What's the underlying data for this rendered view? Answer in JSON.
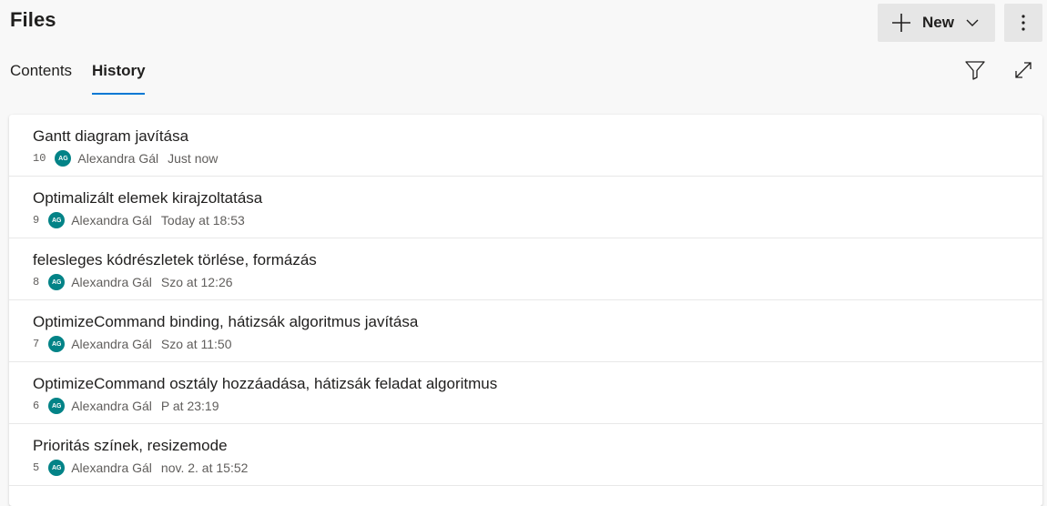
{
  "header": {
    "title": "Files",
    "new_label": "New"
  },
  "tabs": [
    {
      "label": "Contents",
      "active": false
    },
    {
      "label": "History",
      "active": true
    }
  ],
  "accent_color": "#0078d4",
  "avatar_color": "#038387",
  "commits": [
    {
      "id": "10",
      "message": "Gantt diagram javítása",
      "initials": "AG",
      "author": "Alexandra Gál",
      "time": "Just now"
    },
    {
      "id": "9",
      "message": "Optimalizált elemek kirajzoltatása",
      "initials": "AG",
      "author": "Alexandra Gál",
      "time": "Today at 18:53"
    },
    {
      "id": "8",
      "message": "felesleges kódrészletek törlése, formázás",
      "initials": "AG",
      "author": "Alexandra Gál",
      "time": "Szo at 12:26"
    },
    {
      "id": "7",
      "message": "OptimizeCommand binding, hátizsák algoritmus javítása",
      "initials": "AG",
      "author": "Alexandra Gál",
      "time": "Szo at 11:50"
    },
    {
      "id": "6",
      "message": "OptimizeCommand osztály hozzáadása, hátizsák feladat algoritmus",
      "initials": "AG",
      "author": "Alexandra Gál",
      "time": "P at 23:19"
    },
    {
      "id": "5",
      "message": "Prioritás színek, resizemode",
      "initials": "AG",
      "author": "Alexandra Gál",
      "time": "nov. 2. at 15:52"
    }
  ]
}
